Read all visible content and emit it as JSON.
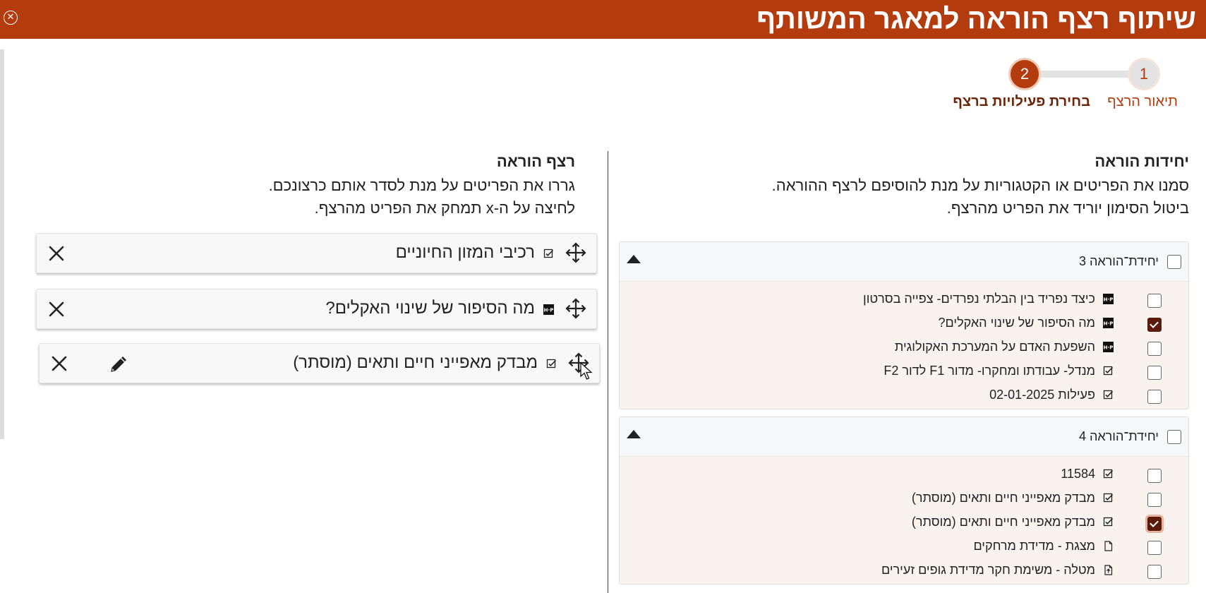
{
  "header": {
    "title": "שיתוף רצף הוראה למאגר המשותף",
    "close_icon": "close-circle-icon"
  },
  "stepper": {
    "steps": [
      {
        "number": "1",
        "label": "תיאור הרצף",
        "state": "done"
      },
      {
        "number": "2",
        "label": "בחירת פעילויות ברצף",
        "state": "active"
      }
    ]
  },
  "units_panel": {
    "heading": "יחידות הוראה",
    "desc_line1": "סמנו את הפריטים או הקטגוריות על מנת להוסיפם לרצף ההוראה.",
    "desc_line2": "ביטול הסימון יוריד את הפריט מהרצף.",
    "units": [
      {
        "title": "יחידת־הוראה 3",
        "checked": false,
        "items": [
          {
            "label": "כיצד נפריד בין הבלתי נפרדים- צפייה בסרטון",
            "icon": "h5p-icon",
            "checked": false
          },
          {
            "label": "מה הסיפור של שינוי האקלים?",
            "icon": "h5p-icon",
            "checked": true
          },
          {
            "label": "השפעת האדם על המערכת האקולוגית",
            "icon": "h5p-icon",
            "checked": false
          },
          {
            "label": "מנדל- עבודתו ומחקרו- מדור F1 לדור F2",
            "icon": "checklist-icon",
            "checked": false
          },
          {
            "label": "פעילות 02-01-2025",
            "icon": "checklist-icon",
            "checked": false
          }
        ]
      },
      {
        "title": "יחידת־הוראה 4",
        "checked": false,
        "items": [
          {
            "label": "11584",
            "icon": "checklist-icon",
            "checked": false
          },
          {
            "label": "מבדק מאפייני חיים ותאים (מוסתר)",
            "icon": "checklist-icon",
            "checked": false
          },
          {
            "label": "מבדק מאפייני חיים ותאים (מוסתר)",
            "icon": "checklist-icon",
            "checked": true
          },
          {
            "label": "מצגת - מדידת מרחקים",
            "icon": "document-icon",
            "checked": false
          },
          {
            "label": "מטלה - משימת חקר מדידת גופים זעירים",
            "icon": "upload-document-icon",
            "checked": false
          }
        ]
      }
    ]
  },
  "sequence_panel": {
    "heading": "רצף הוראה",
    "desc_line1": "גררו את הפריטים על מנת לסדר אותם כרצונכם.",
    "desc_line2": "לחיצה על ה-x תמחק את הפריט מהרצף.",
    "items": [
      {
        "label": "רכיבי המזון החיוניים",
        "icon": "checklist-icon",
        "editable": false
      },
      {
        "label": "מה הסיפור של שינוי האקלים?",
        "icon": "h5p-icon",
        "editable": false
      },
      {
        "label": "מבדק מאפייני חיים ותאים (מוסתר)",
        "icon": "checklist-icon",
        "editable": true
      }
    ]
  },
  "colors": {
    "brand": "#b33b0e",
    "checked": "#5c1a0a",
    "unit_bg": "#f8f3ef"
  }
}
